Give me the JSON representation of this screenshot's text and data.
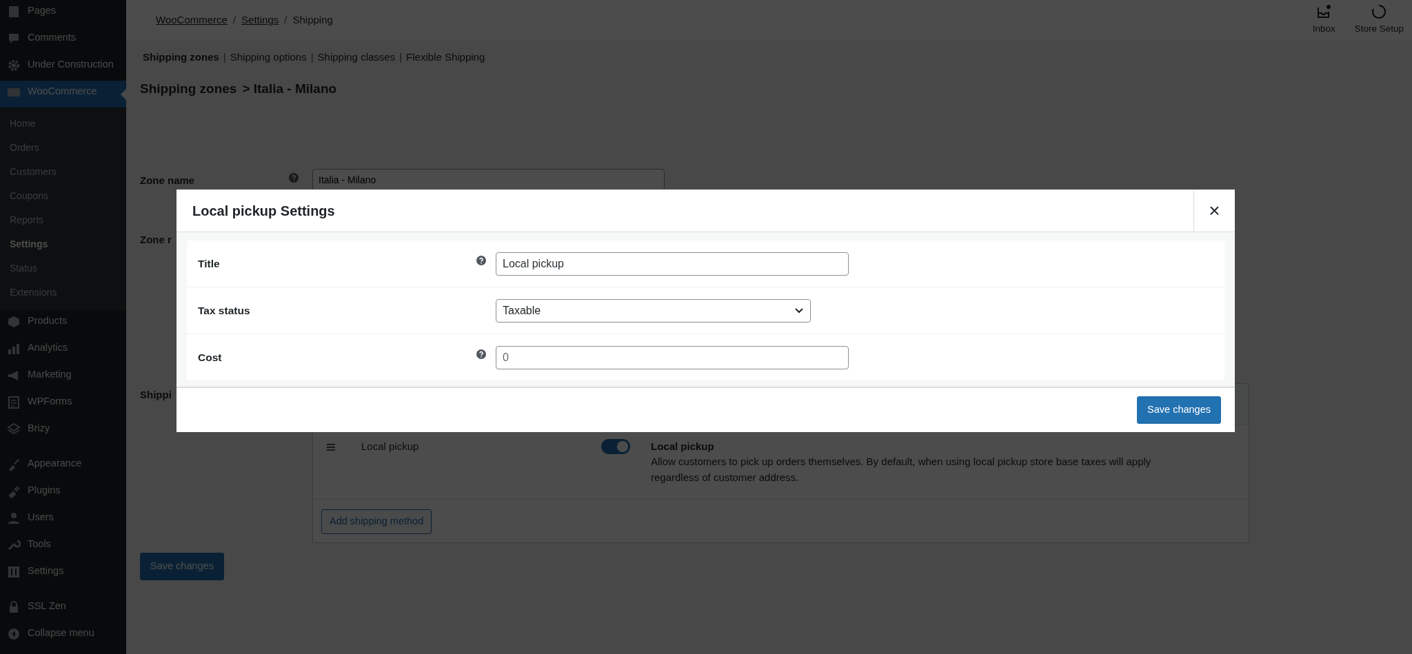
{
  "sidebar": {
    "items": [
      {
        "label": "Pages",
        "selected": false
      },
      {
        "label": "Comments",
        "selected": false
      },
      {
        "label": "Under Construction",
        "selected": false
      },
      {
        "label": "WooCommerce",
        "selected": true,
        "children": [
          {
            "label": "Home",
            "selected": false
          },
          {
            "label": "Orders",
            "selected": false
          },
          {
            "label": "Customers",
            "selected": false
          },
          {
            "label": "Coupons",
            "selected": false
          },
          {
            "label": "Reports",
            "selected": false
          },
          {
            "label": "Settings",
            "selected": true
          },
          {
            "label": "Status",
            "selected": false
          },
          {
            "label": "Extensions",
            "selected": false
          }
        ]
      },
      {
        "label": "Products",
        "selected": false
      },
      {
        "label": "Analytics",
        "selected": false
      },
      {
        "label": "Marketing",
        "selected": false
      },
      {
        "label": "WPForms",
        "selected": false
      },
      {
        "label": "Brizy",
        "selected": false
      },
      {
        "label": "Appearance",
        "selected": false
      },
      {
        "label": "Plugins",
        "selected": false
      },
      {
        "label": "Users",
        "selected": false
      },
      {
        "label": "Tools",
        "selected": false
      },
      {
        "label": "Settings",
        "selected": false
      },
      {
        "label": "SSL Zen",
        "selected": false
      },
      {
        "label": "Collapse menu",
        "selected": false
      }
    ]
  },
  "topbar": {
    "separator": "/",
    "breadcrumb": [
      {
        "label": "WooCommerce",
        "link": true
      },
      {
        "label": "Settings",
        "link": true
      },
      {
        "label": "Shipping",
        "link": false
      }
    ],
    "actions": [
      {
        "label": "Inbox"
      },
      {
        "label": "Store Setup"
      }
    ]
  },
  "subnav_separator": "|",
  "subnav": [
    {
      "label": "Shipping zones",
      "selected": true
    },
    {
      "label": "Shipping options",
      "selected": false
    },
    {
      "label": "Shipping classes",
      "selected": false
    },
    {
      "label": "Flexible Shipping",
      "selected": false
    }
  ],
  "heading": {
    "link": "Shipping zones",
    "rest": "> Italia - Milano"
  },
  "zone_form": {
    "rows": [
      {
        "label": "Zone name",
        "help": true,
        "value": "Italia - Milano"
      },
      {
        "label": "Zone r",
        "help": false
      },
      {
        "label": "Shippi",
        "help": false
      }
    ]
  },
  "methods": [
    {
      "name": "Local pickup",
      "enabled": true,
      "title": "Local pickup",
      "description": "Allow customers to pick up orders themselves. By default, when using local pickup store base taxes will apply regardless of customer address."
    }
  ],
  "add_method_button": "Add shipping method",
  "save_button": "Save changes",
  "modal": {
    "title": "Local pickup Settings",
    "close": "×",
    "fields": [
      {
        "kind": "text",
        "label": "Title",
        "help": true,
        "value": "Local pickup"
      },
      {
        "kind": "select",
        "label": "Tax status",
        "help": false,
        "value": "Taxable"
      },
      {
        "kind": "text",
        "label": "Cost",
        "help": true,
        "placeholder": "0"
      }
    ],
    "save_button": "Save changes"
  }
}
